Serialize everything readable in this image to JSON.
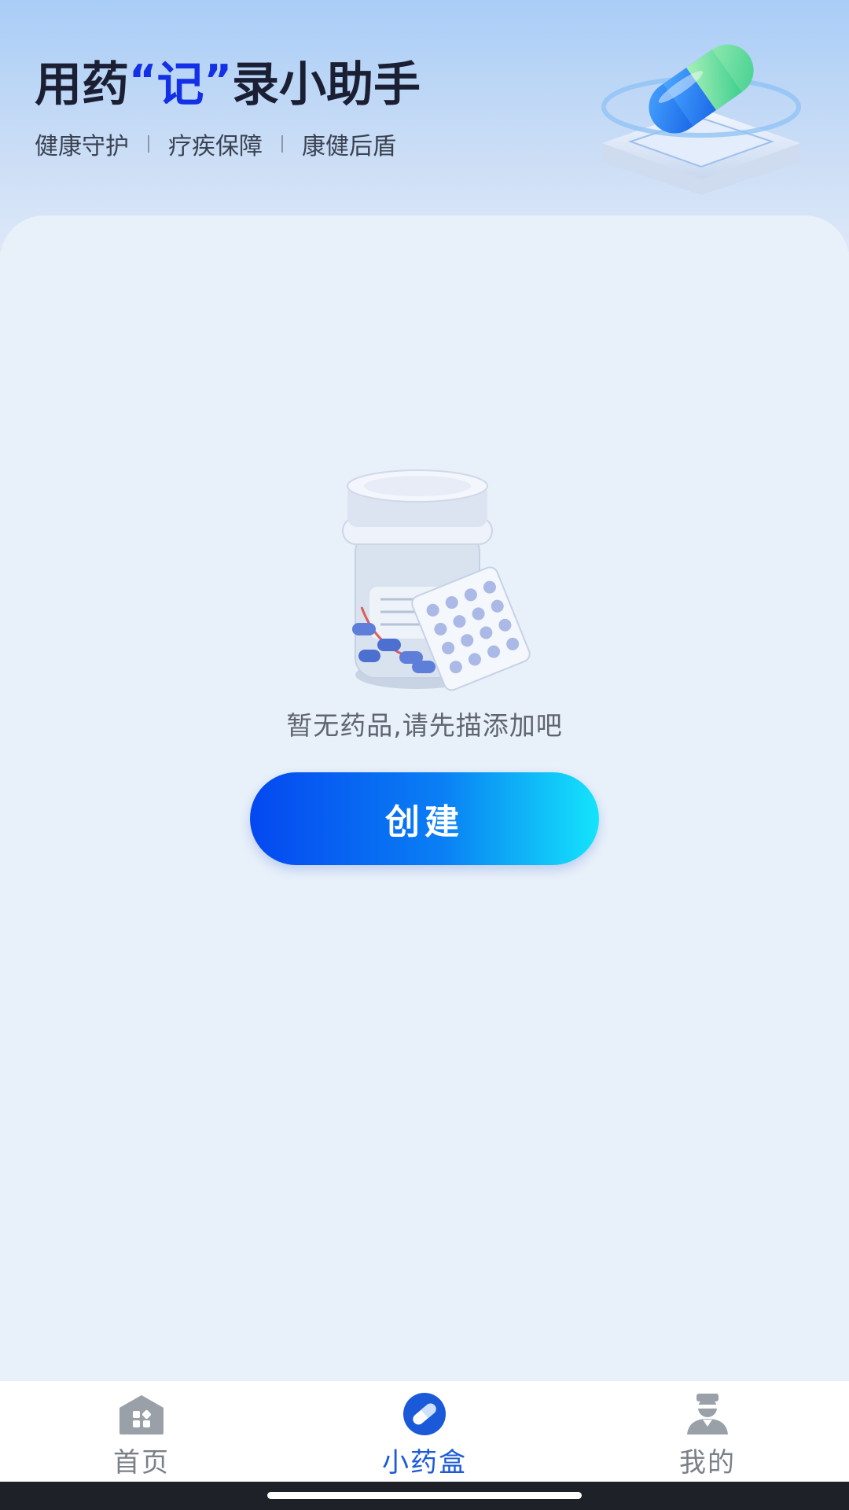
{
  "header": {
    "title_part1": "用药",
    "open_quote": "“",
    "title_highlight": "记",
    "close_quote": " ”",
    "title_part2": "录小助手",
    "taglines": [
      "健康守护",
      "疗疾保障",
      "康健后盾"
    ]
  },
  "empty_state": {
    "message": "暂无药品,请先描添加吧",
    "create_label": "创建"
  },
  "tabbar": {
    "tabs": [
      {
        "label": "首页",
        "icon": "home-icon",
        "active": false
      },
      {
        "label": "小药盒",
        "icon": "pill-icon",
        "active": true
      },
      {
        "label": "我的",
        "icon": "user-icon",
        "active": false
      }
    ]
  },
  "colors": {
    "accent": "#1a5ad8",
    "title_highlight": "#1330e6",
    "button_gradient_start": "#0448f0",
    "button_gradient_end": "#14e4fb",
    "tab_inactive": "#7b8088"
  }
}
